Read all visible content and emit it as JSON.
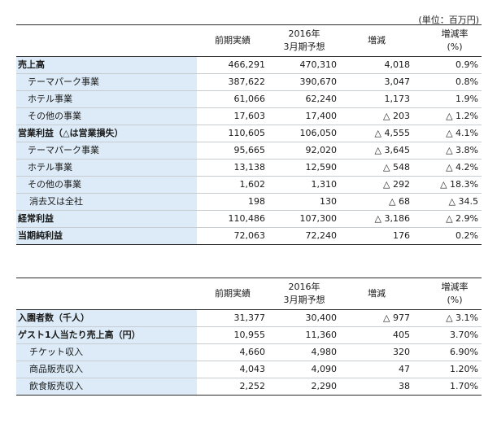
{
  "unit_note": "(単位：百万円)",
  "headers": {
    "col1": "前期実績",
    "col2_line1": "2016年",
    "col2_line2": "3月期予想",
    "col3": "増減",
    "col4_line1": "増減率",
    "col4_line2": "(%)"
  },
  "table1": {
    "rows": [
      {
        "label": "売上高",
        "level": 0,
        "prev": "466,291",
        "forecast": "470,310",
        "change": "4,018",
        "rate": "0.9%"
      },
      {
        "label": "テーマパーク事業",
        "level": 1,
        "prev": "387,622",
        "forecast": "390,670",
        "change": "3,047",
        "rate": "0.8%"
      },
      {
        "label": "ホテル事業",
        "level": 1,
        "prev": "61,066",
        "forecast": "62,240",
        "change": "1,173",
        "rate": "1.9%"
      },
      {
        "label": "その他の事業",
        "level": 1,
        "prev": "17,603",
        "forecast": "17,400",
        "change": "△ 203",
        "rate": "△ 1.2%"
      },
      {
        "label": "営業利益（△は営業損失）",
        "level": 0,
        "prev": "110,605",
        "forecast": "106,050",
        "change": "△ 4,555",
        "rate": "△ 4.1%"
      },
      {
        "label": "テーマパーク事業",
        "level": 1,
        "prev": "95,665",
        "forecast": "92,020",
        "change": "△ 3,645",
        "rate": "△ 3.8%"
      },
      {
        "label": "ホテル事業",
        "level": 1,
        "prev": "13,138",
        "forecast": "12,590",
        "change": "△ 548",
        "rate": "△ 4.2%"
      },
      {
        "label": "その他の事業",
        "level": 1,
        "prev": "1,602",
        "forecast": "1,310",
        "change": "△ 292",
        "rate": "△ 18.3%"
      },
      {
        "label": "消去又は全社",
        "level": 2,
        "prev": "198",
        "forecast": "130",
        "change": "△ 68",
        "rate": "△ 34.5"
      },
      {
        "label": "経常利益",
        "level": 0,
        "prev": "110,486",
        "forecast": "107,300",
        "change": "△ 3,186",
        "rate": "△ 2.9%"
      },
      {
        "label": "当期純利益",
        "level": 0,
        "prev": "72,063",
        "forecast": "72,240",
        "change": "176",
        "rate": "0.2%"
      }
    ]
  },
  "table2": {
    "rows": [
      {
        "label": "入園者数（千人）",
        "level": 0,
        "prev": "31,377",
        "forecast": "30,400",
        "change": "△ 977",
        "rate": "△ 3.1%"
      },
      {
        "label": "ゲスト1人当たり売上高（円）",
        "level": 0,
        "prev": "10,955",
        "forecast": "11,360",
        "change": "405",
        "rate": "3.70%"
      },
      {
        "label": "チケット収入",
        "level": 2,
        "prev": "4,660",
        "forecast": "4,980",
        "change": "320",
        "rate": "6.90%"
      },
      {
        "label": "商品販売収入",
        "level": 2,
        "prev": "4,043",
        "forecast": "4,090",
        "change": "47",
        "rate": "1.20%"
      },
      {
        "label": "飲食販売収入",
        "level": 2,
        "prev": "2,252",
        "forecast": "2,290",
        "change": "38",
        "rate": "1.70%"
      }
    ]
  }
}
